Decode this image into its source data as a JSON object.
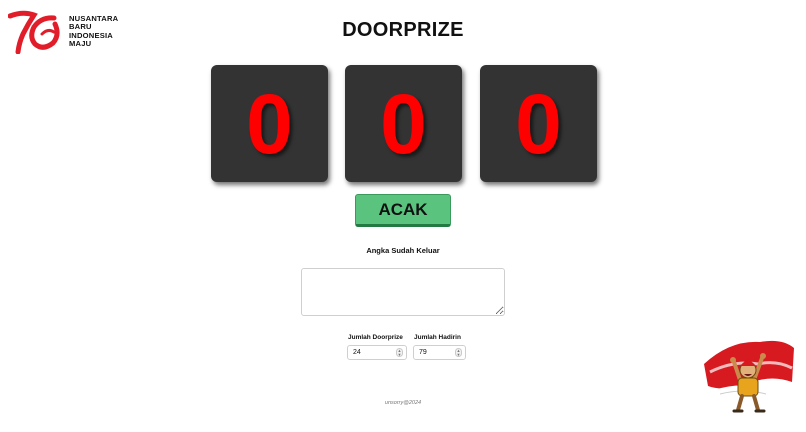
{
  "logo": {
    "lines": [
      "NUSANTARA",
      "BARU",
      "INDONESIA",
      "MAJU"
    ],
    "mark_color": "#e11d2a"
  },
  "title": "DOORPRIZE",
  "digits": [
    "0",
    "0",
    "0"
  ],
  "digit_color": "#ff0000",
  "acak_button": "ACAK",
  "accent_green": "#5ac47f",
  "drawn_numbers_label": "Angka Sudah Keluar",
  "drawn_numbers_value": "",
  "jumlah_doorprize": {
    "label": "Jumlah Doorprize",
    "value": "24"
  },
  "jumlah_hadirin": {
    "label": "Jumlah Hadirin",
    "value": "79"
  },
  "footer": "unsorry@2024",
  "mascot_icon": "celebrating-man-flag-icon"
}
